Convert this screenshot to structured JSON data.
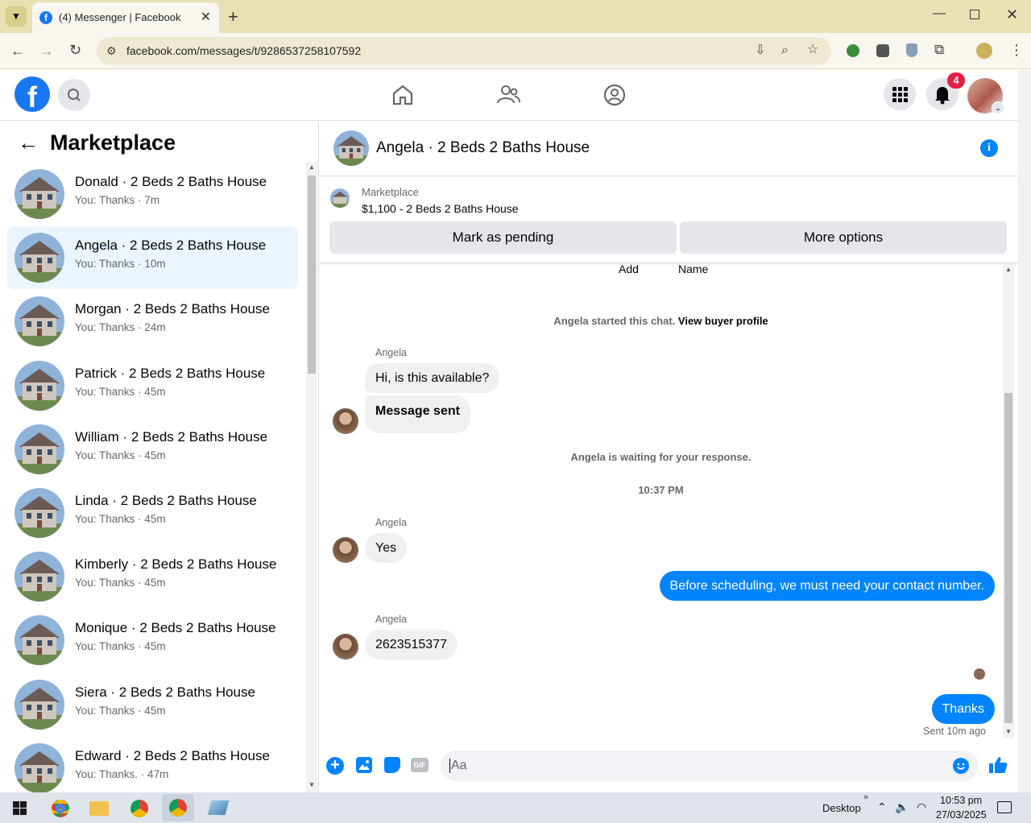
{
  "browser": {
    "tab_title": "(4) Messenger | Facebook",
    "url": "facebook.com/messages/t/9286537258107592"
  },
  "fb": {
    "notification_count": "4"
  },
  "sidebar": {
    "title": "Marketplace",
    "conversations": [
      {
        "name": "Donald · 2 Beds 2 Baths House",
        "snippet": "You: Thanks · 7m",
        "active": false
      },
      {
        "name": "Angela · 2 Beds 2 Baths House",
        "snippet": "You: Thanks · 10m",
        "active": true
      },
      {
        "name": "Morgan · 2 Beds 2 Baths House",
        "snippet": "You: Thanks · 24m",
        "active": false
      },
      {
        "name": "Patrick · 2 Beds 2 Baths House",
        "snippet": "You: Thanks · 45m",
        "active": false
      },
      {
        "name": "William · 2 Beds 2 Baths House",
        "snippet": "You: Thanks · 45m",
        "active": false
      },
      {
        "name": "Linda · 2 Beds 2 Baths House",
        "snippet": "You: Thanks · 45m",
        "active": false
      },
      {
        "name": "Kimberly · 2 Beds 2 Baths House",
        "snippet": "You: Thanks · 45m",
        "active": false
      },
      {
        "name": "Monique · 2 Beds 2 Baths House",
        "snippet": "You: Thanks · 45m",
        "active": false
      },
      {
        "name": "Siera · 2 Beds 2 Baths House",
        "snippet": "You: Thanks · 45m",
        "active": false
      },
      {
        "name": "Edward · 2 Beds 2 Baths House",
        "snippet": "You: Thanks. · 47m",
        "active": false
      }
    ]
  },
  "chat": {
    "header_title": "Angela · 2 Beds 2 Baths House",
    "listing_source": "Marketplace",
    "listing_title": "$1,100 - 2 Beds 2 Baths House",
    "mark_pending_label": "Mark as pending",
    "more_options_label": "More options",
    "top_links": [
      "Add",
      "Name"
    ],
    "started_text": "Angela started this chat.",
    "view_profile_label": "View buyer profile",
    "sender_name": "Angela",
    "msg1": "Hi, is this available?",
    "msg2": "Message sent",
    "waiting_text": "Angela is waiting for your response.",
    "timestamp": "10:37 PM",
    "msg3": "Yes",
    "msg4": "Before scheduling, we must need your contact number.",
    "msg5": "2623515377",
    "msg6": "Thanks",
    "sent_status": "Sent 10m ago",
    "composer_placeholder": "Aa"
  },
  "taskbar": {
    "desktop_label": "Desktop",
    "time": "10:53 pm",
    "date": "27/03/2025"
  },
  "colors": {
    "fb_blue": "#1877f2",
    "messenger_blue": "#0084ff",
    "badge_red": "#e41e3f"
  }
}
